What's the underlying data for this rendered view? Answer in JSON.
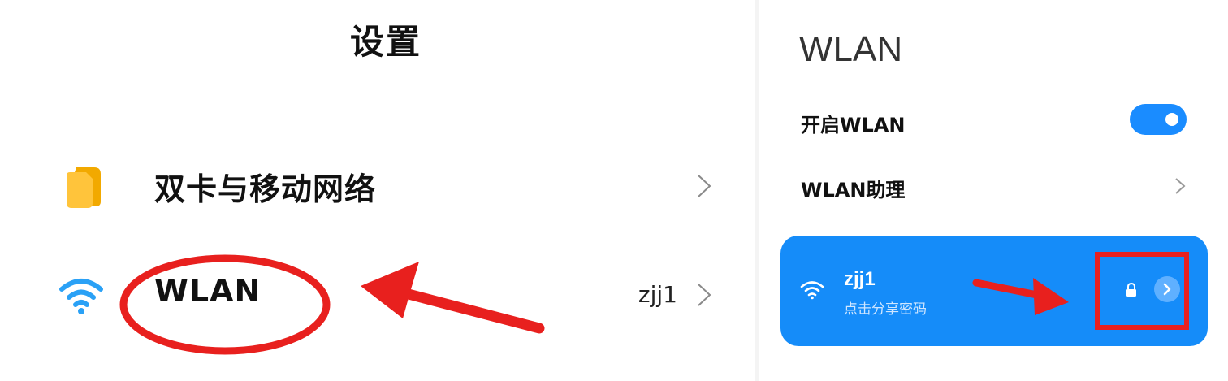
{
  "left": {
    "title": "设置",
    "rows": [
      {
        "label": "双卡与移动网络",
        "icon": "sim-card-icon",
        "value": ""
      },
      {
        "label": "WLAN",
        "icon": "wifi-icon",
        "value": "zjj1"
      }
    ]
  },
  "right": {
    "title": "WLAN",
    "wlan_toggle_label": "开启WLAN",
    "wlan_enabled": true,
    "assistant_label": "WLAN助理",
    "network": {
      "name": "zjj1",
      "subtitle": "点击分享密码",
      "secured": true
    }
  },
  "colors": {
    "accent_blue": "#158cf9",
    "toggle_blue": "#1a8cff",
    "annotation_red": "#e8201e",
    "sim_icon": "#ffc43b",
    "wifi_icon": "#2aa1f6"
  },
  "annotations": [
    "ellipse-around-wlan",
    "arrow-to-wlan",
    "arrow-to-details",
    "box-around-details"
  ]
}
